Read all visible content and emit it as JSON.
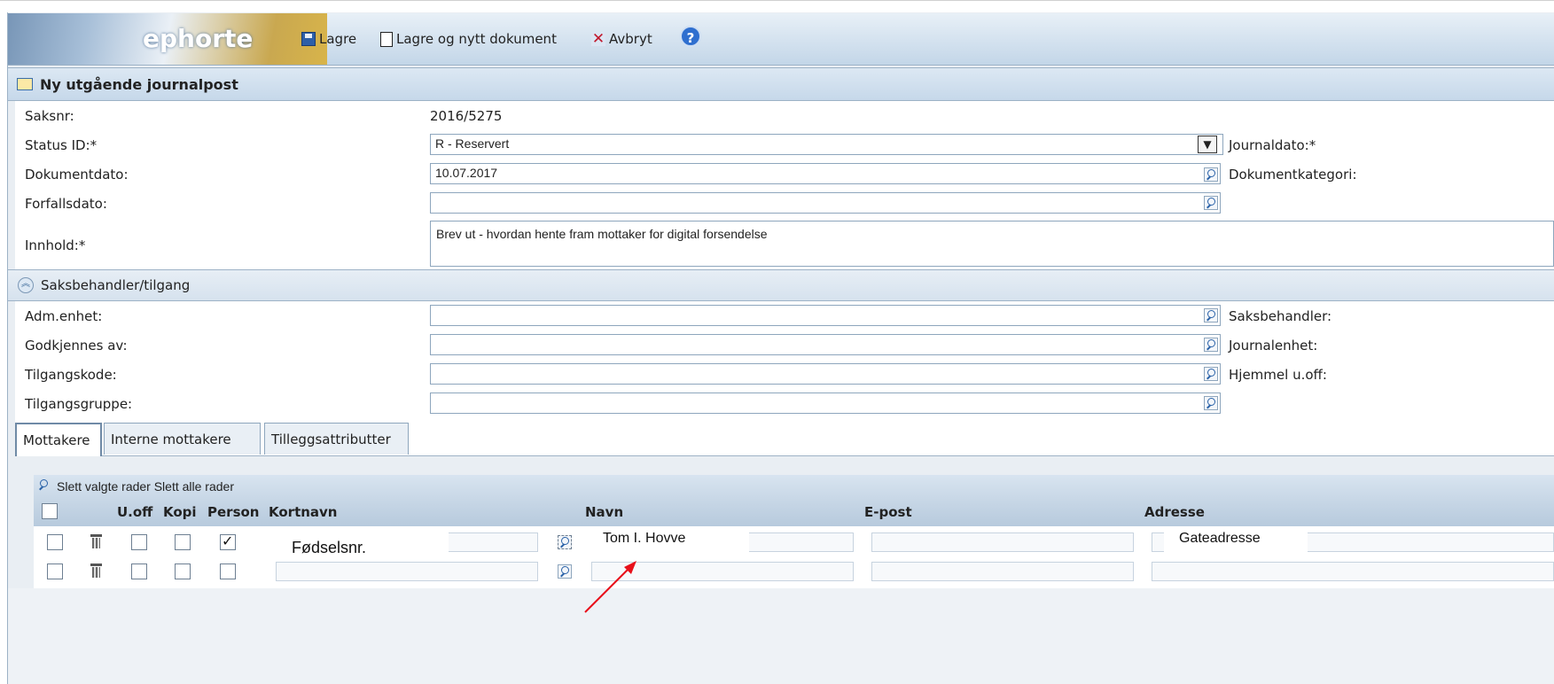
{
  "app": {
    "logo": "ephorte"
  },
  "toolbar": {
    "save_label": "Lagre",
    "save_new_label": "Lagre og nytt dokument",
    "cancel_label": "Avbryt",
    "help_glyph": "?"
  },
  "header": {
    "title": "Ny utgående journalpost"
  },
  "form": {
    "saksnr_label": "Saksnr:",
    "saksnr_value": "2016/5275",
    "status_label": "Status ID:*",
    "status_value": "R - Reservert",
    "dokumentdato_label": "Dokumentdato:",
    "dokumentdato_value": "10.07.2017",
    "forfallsdato_label": "Forfallsdato:",
    "forfallsdato_value": "",
    "innhold_label": "Innhold:*",
    "innhold_value": "Brev ut - hvordan hente fram mottaker for digital forsendelse",
    "journaldato_label": "Journaldato:*",
    "dokumentkategori_label": "Dokumentkategori:"
  },
  "access_section": {
    "title": "Saksbehandler/tilgang",
    "adm_enhet_label": "Adm.enhet:",
    "godkjennes_label": "Godkjennes av:",
    "tilgangskode_label": "Tilgangskode:",
    "tilgangsgruppe_label": "Tilgangsgruppe:",
    "saksbehandler_label": "Saksbehandler:",
    "journalenhet_label": "Journalenhet:",
    "hjemmel_label": "Hjemmel u.off:"
  },
  "tabs": [
    {
      "label": "Mottakere",
      "active": true
    },
    {
      "label": "Interne mottakere",
      "active": false
    },
    {
      "label": "Tilleggsattributter",
      "active": false
    }
  ],
  "grid": {
    "toolbar_text": "Slett valgte rader Slett alle rader",
    "headers": {
      "uoff": "U.off",
      "kopi": "Kopi",
      "person": "Person",
      "kortnavn": "Kortnavn",
      "navn": "Navn",
      "epost": "E-post",
      "adresse": "Adresse"
    },
    "rows": [
      {
        "person_checked": true,
        "kortnavn_overlay": "Fødselsnr.",
        "navn_overlay": "Tom I. Hovve",
        "adresse_overlay": "Gateadresse"
      },
      {
        "person_checked": false
      }
    ]
  },
  "colors": {
    "toolbar_bg": "#c3d6e8",
    "section_bg": "#c6d8ea",
    "annotation_arrow": "#e8101a"
  }
}
